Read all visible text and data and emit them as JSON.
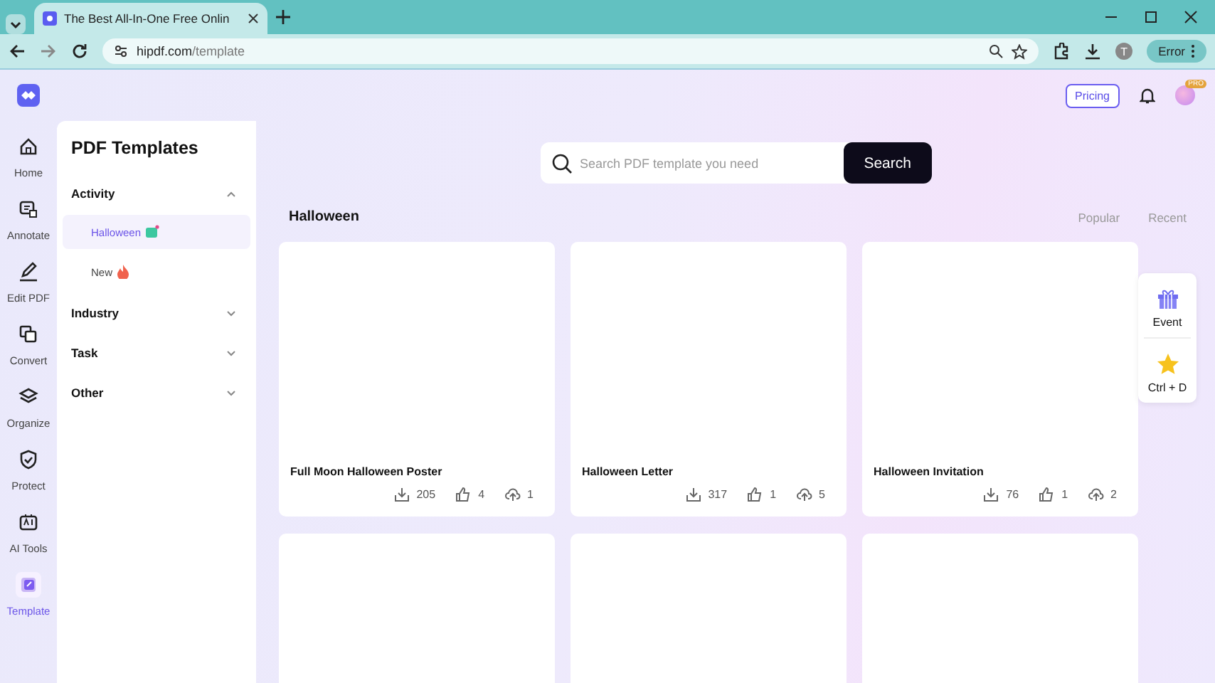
{
  "browser": {
    "tab_title": "The Best All-In-One Free Onlin",
    "url_host": "hipdf.com",
    "url_path": "/template",
    "profile_initial": "T",
    "error_label": "Error"
  },
  "header": {
    "pricing": "Pricing",
    "pro_badge": "PRO"
  },
  "rail": [
    {
      "label": "Home",
      "selected": false
    },
    {
      "label": "Annotate",
      "selected": false
    },
    {
      "label": "Edit PDF",
      "selected": false
    },
    {
      "label": "Convert",
      "selected": false
    },
    {
      "label": "Organize",
      "selected": false
    },
    {
      "label": "Protect",
      "selected": false
    },
    {
      "label": "AI Tools",
      "selected": false
    },
    {
      "label": "Template",
      "selected": true
    }
  ],
  "panel": {
    "title": "PDF Templates",
    "groups": [
      {
        "label": "Activity",
        "expanded": true,
        "children": [
          {
            "label": "Halloween",
            "selected": true
          },
          {
            "label": "New",
            "selected": false
          }
        ]
      },
      {
        "label": "Industry",
        "expanded": false
      },
      {
        "label": "Task",
        "expanded": false
      },
      {
        "label": "Other",
        "expanded": false
      }
    ]
  },
  "search": {
    "placeholder": "Search PDF template you need",
    "button": "Search"
  },
  "section": {
    "title": "Halloween",
    "sorts": [
      "Popular",
      "Recent"
    ]
  },
  "cards": [
    {
      "kind": "template",
      "title": "Full Moon Halloween Poster",
      "downloads": "205",
      "likes": "4",
      "shares": "1"
    },
    {
      "kind": "template",
      "title": "Halloween Letter",
      "downloads": "317",
      "likes": "1",
      "shares": "5"
    },
    {
      "kind": "template",
      "title": "Halloween Invitation",
      "downloads": "76",
      "likes": "1",
      "shares": "2"
    },
    {
      "kind": "blank"
    },
    {
      "kind": "blank"
    },
    {
      "kind": "blank"
    }
  ],
  "side_widget": [
    {
      "kind": "gift",
      "label": "Event"
    },
    {
      "kind": "star",
      "label": "Ctrl + D"
    }
  ]
}
